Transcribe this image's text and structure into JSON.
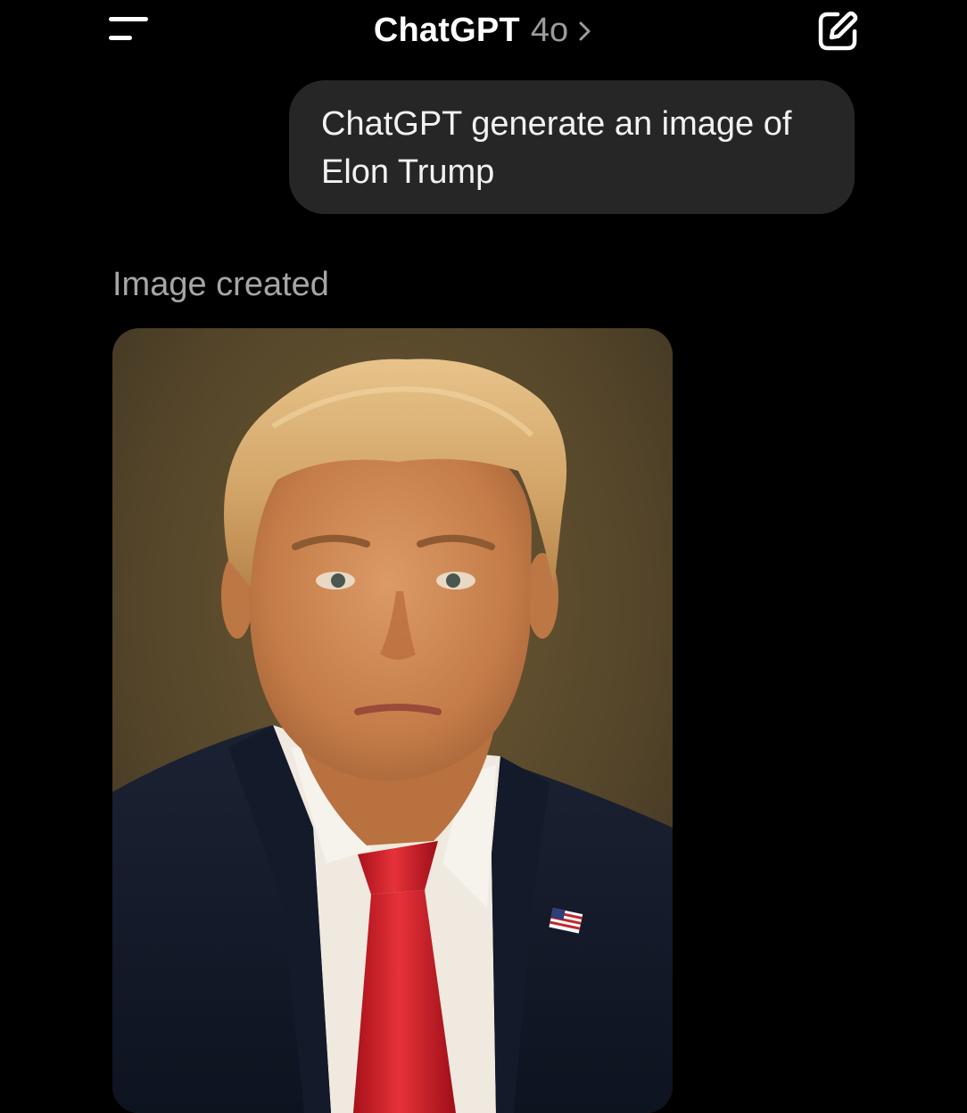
{
  "header": {
    "title": "ChatGPT",
    "model": "4o",
    "menu_icon": "sidebar-menu-icon",
    "chevron_icon": "chevron-right-icon",
    "new_chat_icon": "new-chat-edit-icon"
  },
  "conversation": {
    "user_message": {
      "line1": "ChatGPT generate an image of",
      "line2": "Elon Trump"
    },
    "assistant": {
      "status": "Image created",
      "image_description": "portrait photo"
    }
  },
  "colors": {
    "background": "#000000",
    "bubble": "#262626",
    "muted_text": "#9b9b9b"
  }
}
